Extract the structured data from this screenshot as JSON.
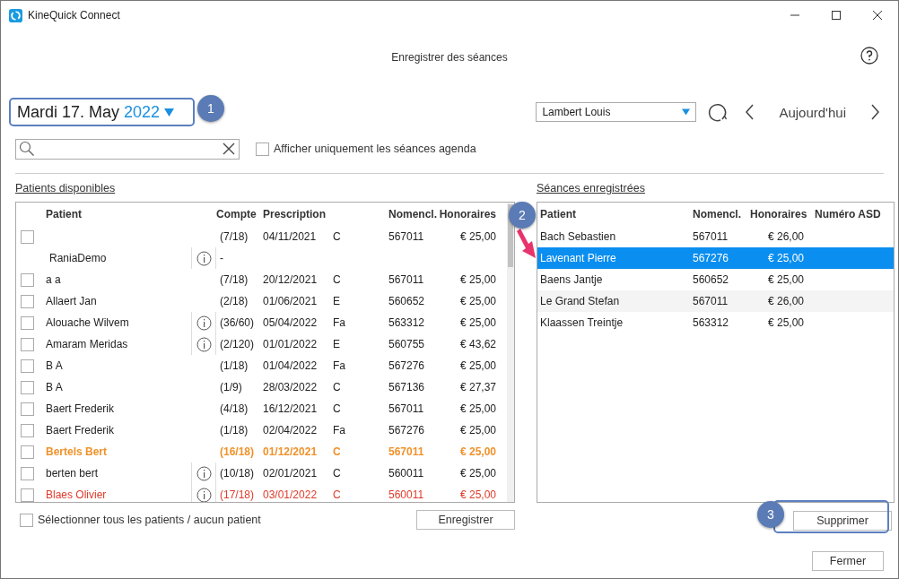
{
  "window": {
    "title": "KineQuick Connect"
  },
  "page_title": "Enregistrer des séances",
  "date_picker": {
    "date": "Mardi 17. May",
    "year": "2022"
  },
  "therapist_select": {
    "value": "Lambert Louis"
  },
  "today_button": "Aujourd'hui",
  "agenda_only": {
    "label": "Afficher uniquement les séances agenda",
    "checked": false
  },
  "available": {
    "title": "Patients disponibles",
    "columns": [
      "Patient",
      "Compte",
      "Prescription",
      "Nomencl.",
      "Honoraires"
    ],
    "rows": [
      {
        "kind": "session",
        "checked": false,
        "patient": "",
        "info": false,
        "counter": "(7/18)",
        "prescription": "04/11/2021",
        "type": "C",
        "code": "567011",
        "fee": "€ 25,00",
        "color": "#222222",
        "bold": false
      },
      {
        "kind": "header",
        "patient": "RaniaDemo",
        "info": true,
        "counter": "-"
      },
      {
        "kind": "session",
        "checked": false,
        "patient": "a a",
        "info": false,
        "counter": "(7/18)",
        "prescription": "20/12/2021",
        "type": "C",
        "code": "567011",
        "fee": "€ 25,00",
        "color": "#222222",
        "bold": false
      },
      {
        "kind": "session",
        "checked": false,
        "patient": "Allaert Jan",
        "info": false,
        "counter": "(2/18)",
        "prescription": "01/06/2021",
        "type": "E",
        "code": "560652",
        "fee": "€ 25,00",
        "color": "#222222",
        "bold": false
      },
      {
        "kind": "session",
        "checked": false,
        "patient": "Alouache Wilvem",
        "info": true,
        "counter": "(36/60)",
        "prescription": "05/04/2022",
        "type": "Fa",
        "code": "563312",
        "fee": "€ 25,00",
        "color": "#222222",
        "bold": false
      },
      {
        "kind": "session",
        "checked": false,
        "patient": "Amaram Meridas",
        "info": true,
        "counter": "(2/120)",
        "prescription": "01/01/2022",
        "type": "E",
        "code": "560755",
        "fee": "€ 43,62",
        "color": "#222222",
        "bold": false
      },
      {
        "kind": "session",
        "checked": false,
        "patient": "B A",
        "info": false,
        "counter": "(1/18)",
        "prescription": "01/04/2022",
        "type": "Fa",
        "code": "567276",
        "fee": "€ 25,00",
        "color": "#222222",
        "bold": false
      },
      {
        "kind": "session",
        "checked": false,
        "patient": "B A",
        "info": false,
        "counter": "(1/9)",
        "prescription": "28/03/2022",
        "type": "C",
        "code": "567136",
        "fee": "€ 27,37",
        "color": "#222222",
        "bold": false
      },
      {
        "kind": "session",
        "checked": false,
        "patient": "Baert Frederik",
        "info": false,
        "counter": "(4/18)",
        "prescription": "16/12/2021",
        "type": "C",
        "code": "567011",
        "fee": "€ 25,00",
        "color": "#222222",
        "bold": false
      },
      {
        "kind": "session",
        "checked": false,
        "patient": "Baert Frederik",
        "info": false,
        "counter": "(1/18)",
        "prescription": "02/04/2022",
        "type": "Fa",
        "code": "567276",
        "fee": "€ 25,00",
        "color": "#222222",
        "bold": false
      },
      {
        "kind": "session",
        "checked": false,
        "patient": "Bertels  Bert",
        "info": false,
        "counter": "(16/18)",
        "prescription": "01/12/2021",
        "type": "C",
        "code": "567011",
        "fee": "€ 25,00",
        "color": "#f0922a",
        "bold": true
      },
      {
        "kind": "session",
        "checked": false,
        "patient": "berten bert",
        "info": true,
        "counter": "(10/18)",
        "prescription": "02/01/2021",
        "type": "C",
        "code": "560011",
        "fee": "€ 25,00",
        "color": "#222222",
        "bold": false
      },
      {
        "kind": "session",
        "checked": false,
        "patient": "Blaes Olivier",
        "info": true,
        "counter": "(17/18)",
        "prescription": "03/01/2022",
        "type": "C",
        "code": "560011",
        "fee": "€ 25,00",
        "color": "#e03a2a",
        "bold": false
      }
    ]
  },
  "select_all": {
    "label": "Sélectionner tous les patients / aucun patient",
    "checked": false
  },
  "save_button": "Enregistrer",
  "recorded": {
    "title": "Séances enregistrées",
    "columns": [
      "Patient",
      "Nomencl.",
      "Honoraires",
      "Numéro ASD"
    ],
    "rows": [
      {
        "patient": "Bach Sebastien",
        "code": "567011",
        "fee": "€ 26,00",
        "selected": false
      },
      {
        "patient": "Lavenant Pierre",
        "code": "567276",
        "fee": "€ 25,00",
        "selected": true
      },
      {
        "patient": "Baens Jantje",
        "code": "560652",
        "fee": "€ 25,00",
        "selected": false
      },
      {
        "patient": "Le Grand Stefan",
        "code": "567011",
        "fee": "€ 26,00",
        "selected": false
      },
      {
        "patient": "Klaassen Treintje",
        "code": "563312",
        "fee": "€ 25,00",
        "selected": false
      }
    ]
  },
  "delete_button": "Supprimer",
  "close_button": "Fermer",
  "callouts": [
    "1",
    "2",
    "3"
  ]
}
